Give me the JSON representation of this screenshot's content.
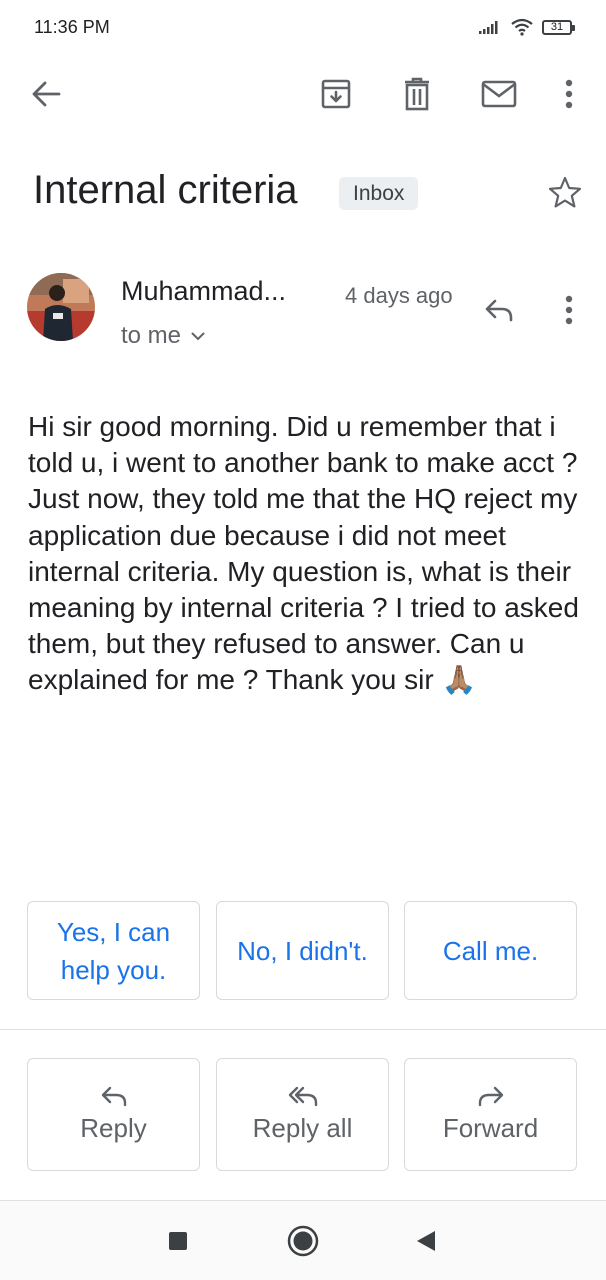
{
  "status_bar": {
    "time": "11:36 PM",
    "battery": "31"
  },
  "toolbar": {
    "back_icon": "arrow-left-icon",
    "archive_icon": "archive-icon",
    "delete_icon": "trash-icon",
    "mark_unread_icon": "mail-icon",
    "more_icon": "more-vert-icon"
  },
  "email": {
    "subject": "Internal criteria",
    "label": "Inbox",
    "sender": "Muhammad...",
    "time": "4 days ago",
    "recipient": "to me",
    "body": "Hi sir good morning. Did u remember that i told u, i went to another bank to make acct ? Just now, they told me that the HQ reject my application due because i did not meet internal criteria. My question is, what is their meaning by internal criteria ? I tried to asked them, but they refused to answer. Can u explained for me ? Thank you sir",
    "emoji": "🙏🏽"
  },
  "smart_replies": [
    {
      "label": "Yes, I can help you."
    },
    {
      "label": "No, I didn't."
    },
    {
      "label": "Call me."
    }
  ],
  "actions": [
    {
      "label": "Reply",
      "icon": "reply-icon"
    },
    {
      "label": "Reply all",
      "icon": "reply-all-icon"
    },
    {
      "label": "Forward",
      "icon": "forward-icon"
    }
  ],
  "colors": {
    "accent": "#1a73e8",
    "text": "#202124",
    "secondary": "#5f6368"
  }
}
